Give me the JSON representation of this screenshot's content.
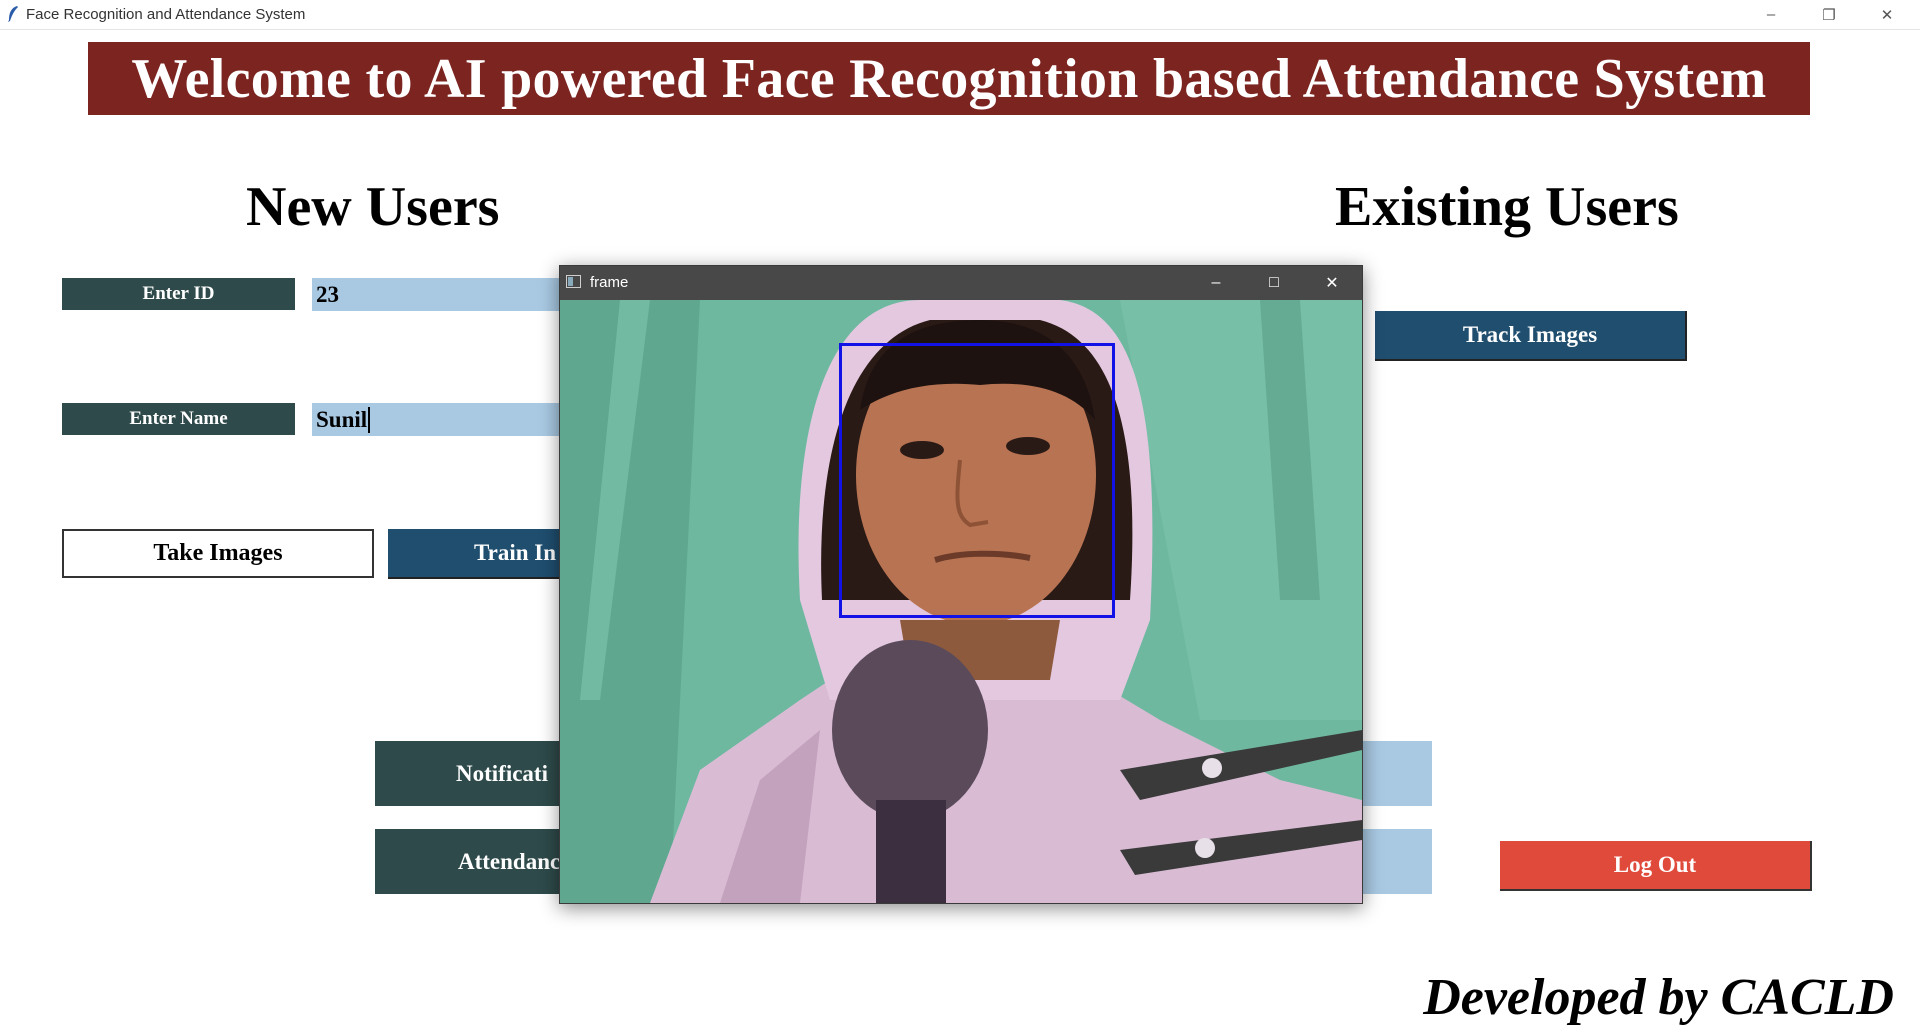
{
  "window": {
    "title": "Face Recognition and Attendance System",
    "minimize": "–",
    "restore": "❐",
    "close": "✕"
  },
  "banner": "Welcome to AI powered Face Recognition based Attendance System",
  "new_users": {
    "title": "New Users",
    "id_label": "Enter ID",
    "id_value": "23",
    "name_label": "Enter Name",
    "name_value": "Sunil",
    "take_images": "Take Images",
    "train_images": "Train In"
  },
  "existing_users": {
    "title": "Existing Users",
    "track_images": "Track Images"
  },
  "bottom_buttons": {
    "notification": "Notificati",
    "attendance": "Attendanc",
    "logout": "Log Out"
  },
  "footer": "Developed by CACLD",
  "frame_window": {
    "title": "frame",
    "minimize": "–",
    "maximize": "□",
    "close": "✕"
  },
  "colors": {
    "banner": "#7b2420",
    "label": "#2e4a4a",
    "entry": "#a9c9e3",
    "button_blue": "#1f4e6f",
    "logout": "#e04a3b",
    "face_box": "#1212e6"
  }
}
